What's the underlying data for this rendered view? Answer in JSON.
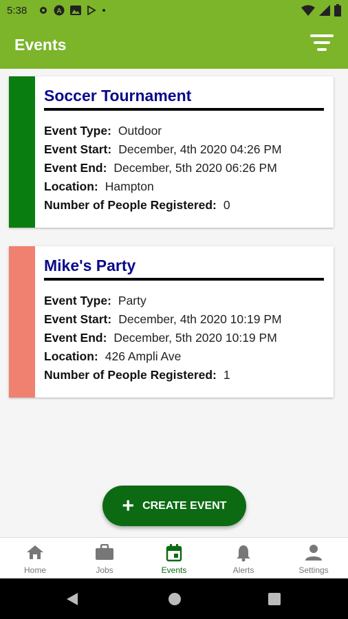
{
  "status": {
    "time": "5:38"
  },
  "app_bar": {
    "title": "Events"
  },
  "events": [
    {
      "title": "Soccer Tournament",
      "accent": "#0a7d10",
      "rows": [
        {
          "label": "Event Type:",
          "value": "Outdoor"
        },
        {
          "label": "Event Start:",
          "value": "December, 4th 2020 04:26 PM"
        },
        {
          "label": "Event End:",
          "value": "December, 5th 2020 06:26 PM"
        },
        {
          "label": "Location:",
          "value": "Hampton"
        },
        {
          "label": "Number of People Registered:",
          "value": "0"
        }
      ]
    },
    {
      "title": "Mike's Party",
      "accent": "#f08070",
      "rows": [
        {
          "label": "Event Type:",
          "value": "Party"
        },
        {
          "label": "Event Start:",
          "value": "December, 4th 2020 10:19 PM"
        },
        {
          "label": "Event End:",
          "value": "December, 5th 2020 10:19 PM"
        },
        {
          "label": "Location:",
          "value": "426 Ampli Ave"
        },
        {
          "label": "Number of People Registered:",
          "value": "1"
        }
      ]
    }
  ],
  "fab": {
    "label": "CREATE EVENT"
  },
  "bottom_nav": [
    {
      "label": "Home",
      "icon": "home-icon"
    },
    {
      "label": "Jobs",
      "icon": "briefcase-icon"
    },
    {
      "label": "Events",
      "icon": "calendar-icon",
      "active": true
    },
    {
      "label": "Alerts",
      "icon": "bell-icon"
    },
    {
      "label": "Settings",
      "icon": "person-icon"
    }
  ],
  "colors": {
    "app_bar": "#7cb42a",
    "fab": "#0c6b12",
    "title": "#0a0a8c"
  }
}
